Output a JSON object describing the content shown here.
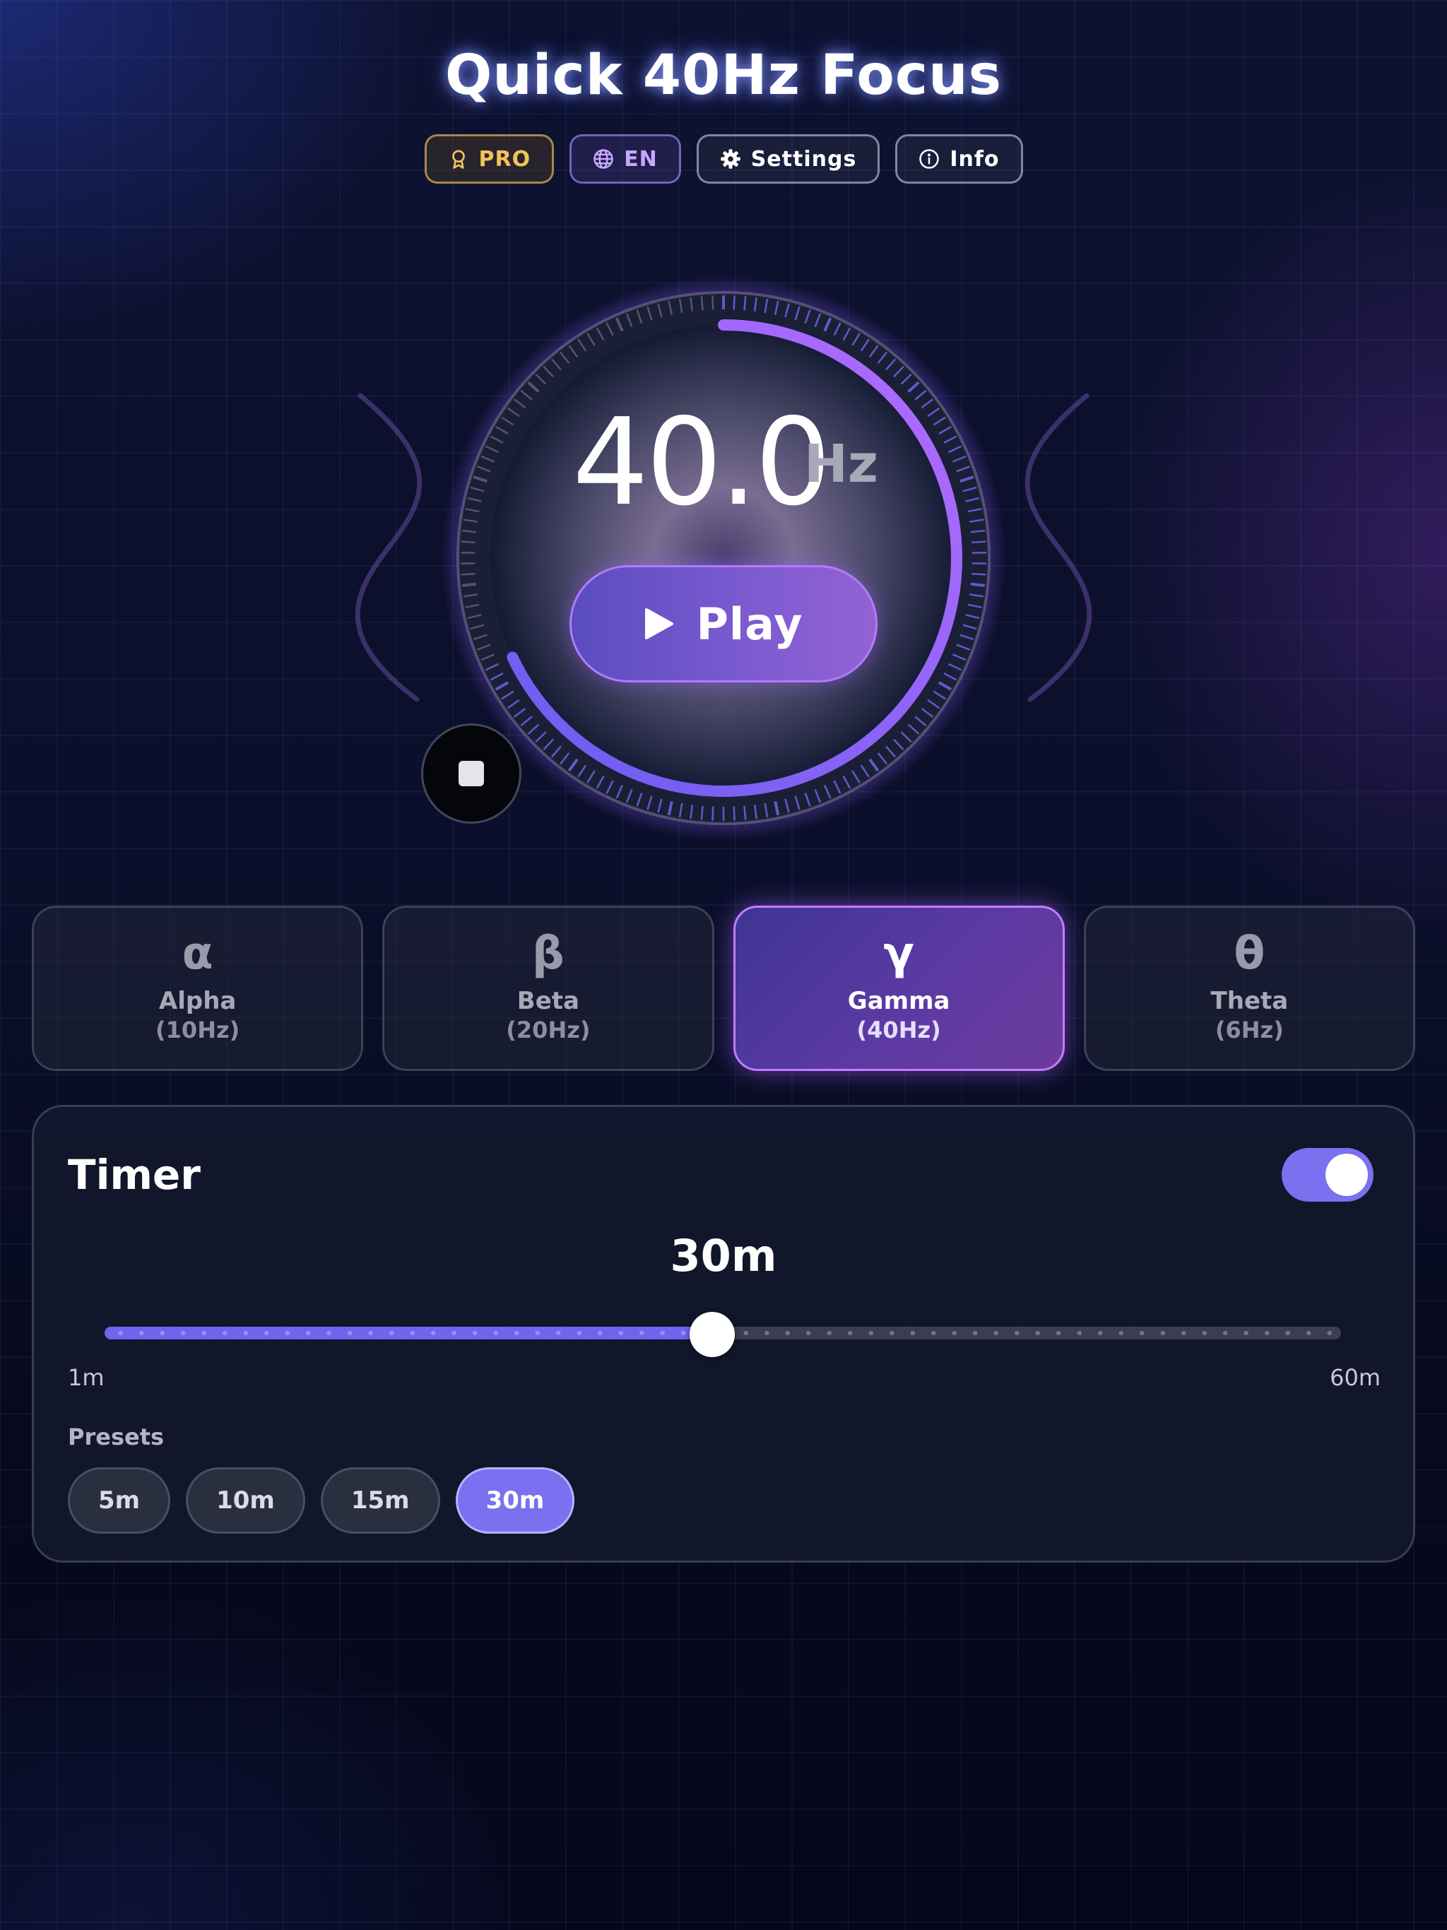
{
  "app": {
    "title": "Quick 40Hz Focus"
  },
  "header": {
    "chips": [
      {
        "label": "PRO",
        "icon": "award-icon"
      },
      {
        "label": "EN",
        "icon": "globe-icon"
      },
      {
        "label": "Settings",
        "icon": "gear-icon"
      },
      {
        "label": "Info",
        "icon": "info-icon"
      }
    ]
  },
  "dial": {
    "value": "40.0",
    "unit": "Hz",
    "play_label": "Play",
    "play_icon": "play-icon",
    "stop_icon": "stop-icon",
    "progress_fraction": 0.68
  },
  "bands": [
    {
      "symbol": "α",
      "name": "Alpha",
      "freq": "(10Hz)",
      "active": false
    },
    {
      "symbol": "β",
      "name": "Beta",
      "freq": "(20Hz)",
      "active": false
    },
    {
      "symbol": "γ",
      "name": "Gamma",
      "freq": "(40Hz)",
      "active": true
    },
    {
      "symbol": "θ",
      "name": "Theta",
      "freq": "(6Hz)",
      "active": false
    }
  ],
  "timer": {
    "title": "Timer",
    "enabled": true,
    "value_label": "30m",
    "value": 30,
    "min": 1,
    "max": 60,
    "min_label": "1m",
    "max_label": "60m",
    "presets_label": "Presets",
    "presets": [
      "5m",
      "10m",
      "15m",
      "30m"
    ],
    "active_preset": 3
  },
  "colors": {
    "accent": "#7a70f0",
    "arc_start": "#6a5cf0",
    "arc_end": "#b46cff",
    "pro": "#f3c25a",
    "lang": "#c8a7ff"
  }
}
